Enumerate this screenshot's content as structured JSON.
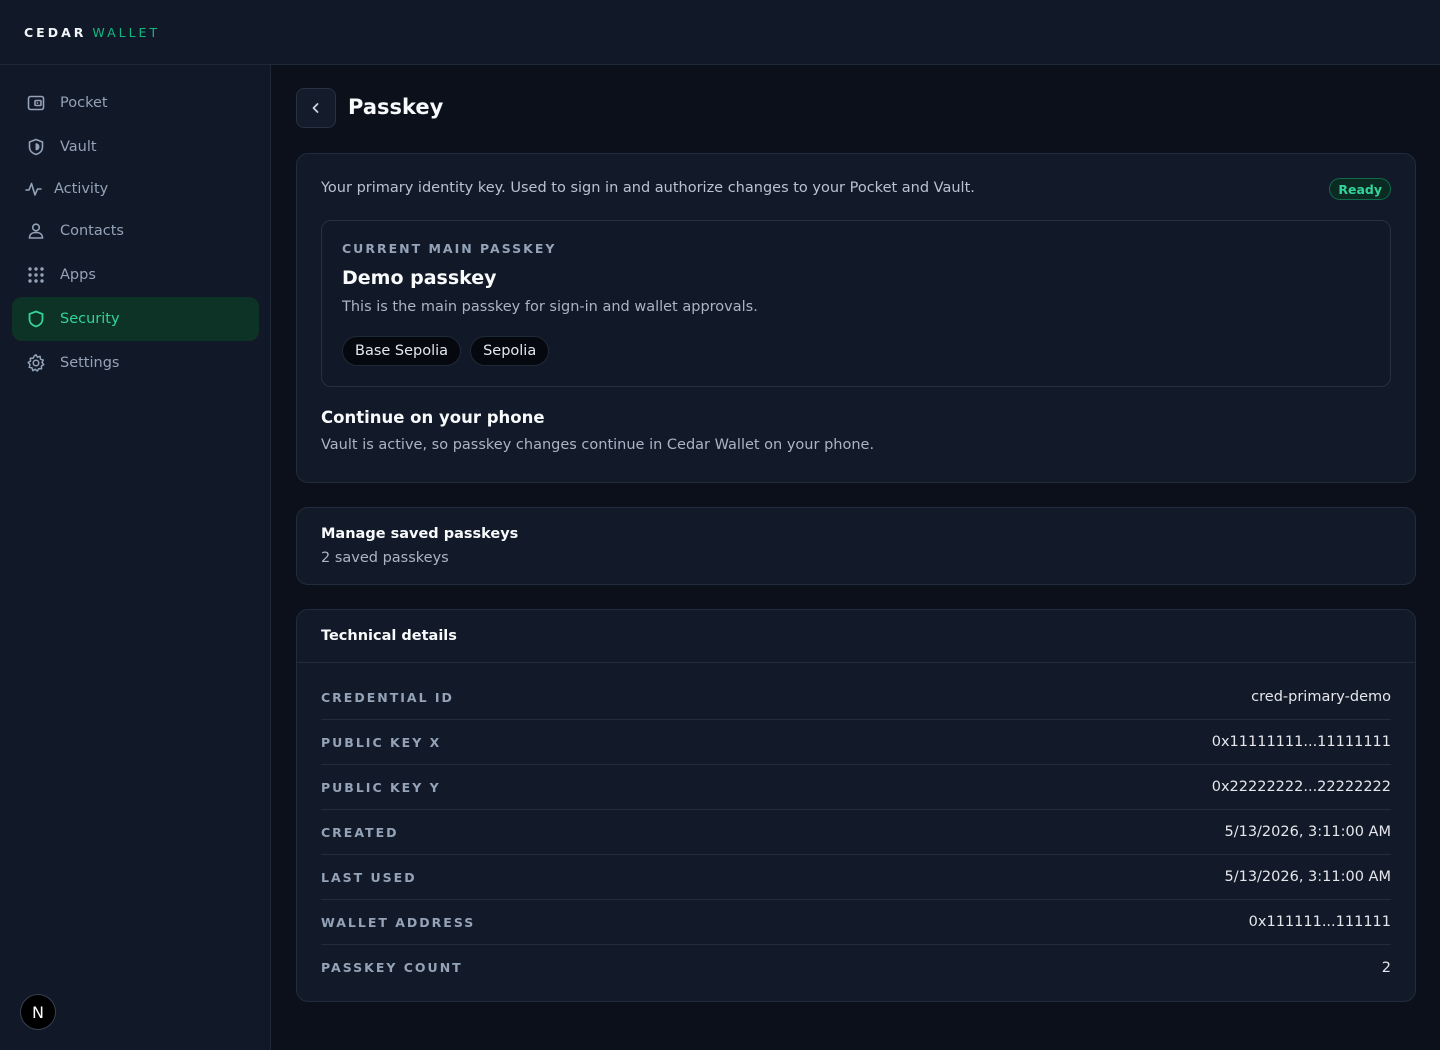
{
  "brand": {
    "name": "CEDAR",
    "accent": "WALLET"
  },
  "sidebar": {
    "items": [
      {
        "label": "Pocket",
        "icon": "wallet-icon"
      },
      {
        "label": "Vault",
        "icon": "shield-icon"
      },
      {
        "label": "Activity",
        "icon": "activity-icon"
      },
      {
        "label": "Contacts",
        "icon": "user-icon"
      },
      {
        "label": "Apps",
        "icon": "grid-icon"
      },
      {
        "label": "Security",
        "icon": "shield-icon",
        "active": true
      },
      {
        "label": "Settings",
        "icon": "gear-icon"
      }
    ],
    "avatar_letter": "N"
  },
  "page": {
    "title": "Passkey"
  },
  "passkey_card": {
    "description": "Your primary identity key. Used to sign in and authorize changes to your Pocket and Vault.",
    "status": "Ready",
    "current": {
      "label": "CURRENT MAIN PASSKEY",
      "name": "Demo passkey",
      "description": "This is the main passkey for sign-in and wallet approvals.",
      "networks": [
        "Base Sepolia",
        "Sepolia"
      ]
    },
    "phone": {
      "title": "Continue on your phone",
      "description": "Vault is active, so passkey changes continue in Cedar Wallet on your phone."
    }
  },
  "manage": {
    "title": "Manage saved passkeys",
    "subtitle": "2 saved passkeys"
  },
  "technical": {
    "title": "Technical details",
    "rows": [
      {
        "label": "CREDENTIAL ID",
        "value": "cred-primary-demo"
      },
      {
        "label": "PUBLIC KEY X",
        "value": "0x11111111...11111111"
      },
      {
        "label": "PUBLIC KEY Y",
        "value": "0x22222222...22222222"
      },
      {
        "label": "CREATED",
        "value": "5/13/2026, 3:11:00 AM"
      },
      {
        "label": "LAST USED",
        "value": "5/13/2026, 3:11:00 AM"
      },
      {
        "label": "WALLET ADDRESS",
        "value": "0x111111...111111"
      },
      {
        "label": "PASSKEY COUNT",
        "value": "2"
      }
    ]
  },
  "colors": {
    "accent": "#10b981",
    "active_bg": "#0d3326",
    "background": "#0b101b",
    "card": "#121a29"
  }
}
